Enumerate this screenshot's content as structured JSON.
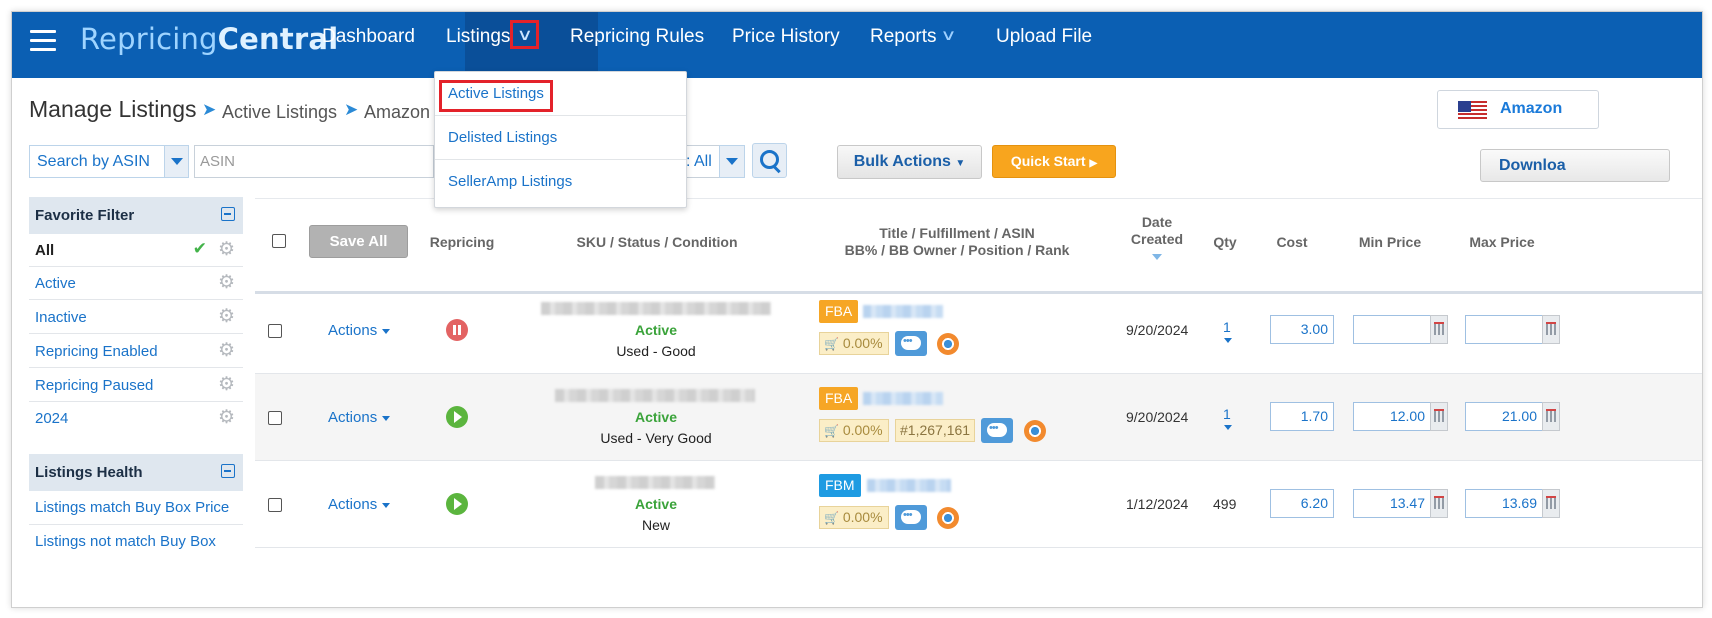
{
  "nav": {
    "logo_part1": "Repricing",
    "logo_part2": "Central",
    "items": [
      "Dashboard",
      "Listings",
      "Repricing Rules",
      "Price History",
      "Reports",
      "Upload File"
    ]
  },
  "listings_menu": [
    "Active Listings",
    "Delisted Listings",
    "SellerAmp Listings"
  ],
  "header": {
    "title": "Manage Listings",
    "breadcrumb": [
      "Active Listings",
      "Amazon"
    ],
    "country_label": "Amazon"
  },
  "toolbar": {
    "search_by": "Search by ASIN",
    "search_placeholder": "ASIN",
    "filter_value": ": All",
    "bulk_actions": "Bulk Actions",
    "quick_start": "Quick Start",
    "download": "Downloa"
  },
  "sidebar": {
    "favorite_title": "Favorite Filter",
    "favorites": [
      "All",
      "Active",
      "Inactive",
      "Repricing Enabled",
      "Repricing Paused",
      "2024"
    ],
    "health_title": "Listings Health",
    "health_items": [
      "Listings match Buy Box Price",
      "Listings not match Buy Box"
    ]
  },
  "table": {
    "save_all": "Save All",
    "headers": {
      "repricing": "Repricing",
      "sku": "SKU / Status / Condition",
      "title_line1": "Title / Fulfillment / ASIN",
      "title_line2": "BB% / BB Owner / Position / Rank",
      "date_line1": "Date",
      "date_line2": "Created",
      "qty": "Qty",
      "cost": "Cost",
      "min_price": "Min Price",
      "max_price": "Max Price"
    },
    "rows": [
      {
        "actions": "Actions",
        "status": "Active",
        "condition": "Used - Good",
        "fulfillment": "FBA",
        "bb": "0.00%",
        "rank": "",
        "date": "9/20/2024",
        "qty": "1",
        "cost": "3.00",
        "min": "",
        "max": "",
        "repricing": "paused"
      },
      {
        "actions": "Actions",
        "status": "Active",
        "condition": "Used - Very Good",
        "fulfillment": "FBA",
        "bb": "0.00%",
        "rank": "#1,267,161",
        "date": "9/20/2024",
        "qty": "1",
        "cost": "1.70",
        "min": "12.00",
        "max": "21.00",
        "repricing": "running"
      },
      {
        "actions": "Actions",
        "status": "Active",
        "condition": "New",
        "fulfillment": "FBM",
        "bb": "0.00%",
        "rank": "",
        "date": "1/12/2024",
        "qty": "499",
        "cost": "6.20",
        "min": "13.47",
        "max": "13.69",
        "repricing": "running"
      }
    ]
  },
  "colors": {
    "nav_bg": "#0b5fb3",
    "accent_link": "#1a73c9",
    "highlight": "#e3222a",
    "fba": "#f6a625",
    "fbm": "#1e9be2",
    "quick_start": "#f8a51e"
  }
}
